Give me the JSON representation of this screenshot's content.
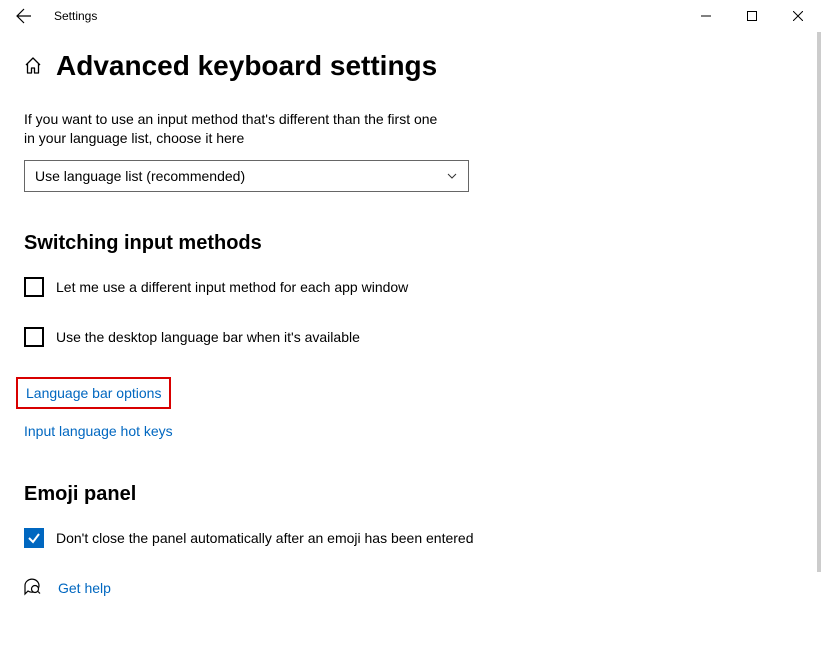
{
  "window": {
    "app_title": "Settings"
  },
  "header": {
    "page_title": "Advanced keyboard settings"
  },
  "main": {
    "description": "If you want to use an input method that's different than the first one in your language list, choose it here",
    "dropdown_value": "Use language list (recommended)"
  },
  "section1": {
    "heading": "Switching input methods",
    "check1_label": "Let me use a different input method for each app window",
    "check2_label": "Use the desktop language bar when it's available",
    "link1": "Language bar options",
    "link2": "Input language hot keys"
  },
  "section2": {
    "heading": "Emoji panel",
    "check1_label": "Don't close the panel automatically after an emoji has been entered"
  },
  "footer": {
    "help_link": "Get help"
  }
}
